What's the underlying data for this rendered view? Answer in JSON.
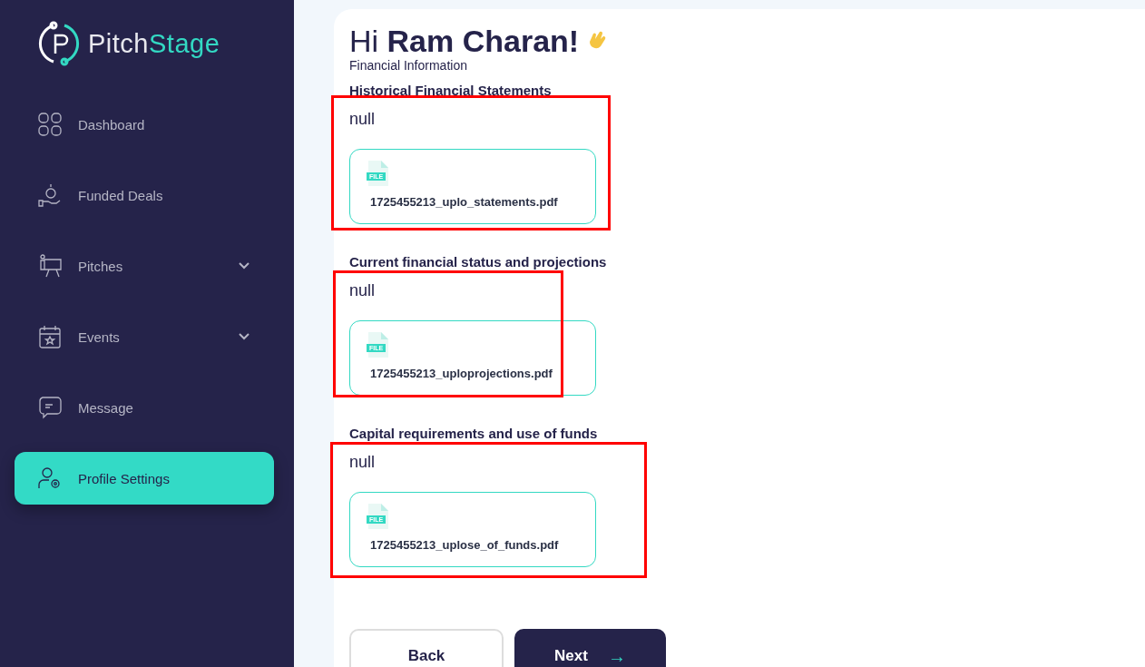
{
  "logo": {
    "word_a": "Pitch",
    "word_b": "Stage"
  },
  "sidebar": {
    "items": [
      {
        "kind": "grid",
        "label": "Dashboard",
        "selected": false,
        "expandable": false
      },
      {
        "kind": "coin",
        "label": "Funded Deals",
        "selected": false,
        "expandable": false
      },
      {
        "kind": "presenter",
        "label": "Pitches",
        "selected": false,
        "expandable": true
      },
      {
        "kind": "calendar",
        "label": "Events",
        "selected": false,
        "expandable": true
      },
      {
        "kind": "chat",
        "label": "Message",
        "selected": false,
        "expandable": false
      },
      {
        "kind": "usergear",
        "label": "Profile Settings",
        "selected": true,
        "expandable": false
      }
    ]
  },
  "greeting": "Hi **Ram Charan!**",
  "section_title": "Financial Information",
  "fields": [
    {
      "label": "Historical Financial Statements",
      "value": "null",
      "file_tag": "FILE",
      "file_name": "1725455213_uplo_statements.pdf",
      "highlighted": true
    },
    {
      "label": "Current financial status and projections",
      "value": "null",
      "file_tag": "FILE",
      "file_name": "1725455213_uploprojections.pdf",
      "highlighted": true
    },
    {
      "label": "Capital requirements and use of funds",
      "value": "null",
      "file_tag": "FILE",
      "file_name": "1725455213_uplose_of_funds.pdf",
      "highlighted": true
    }
  ],
  "buttons": {
    "back": "Back",
    "next": "Next",
    "next_arrow": "→"
  }
}
